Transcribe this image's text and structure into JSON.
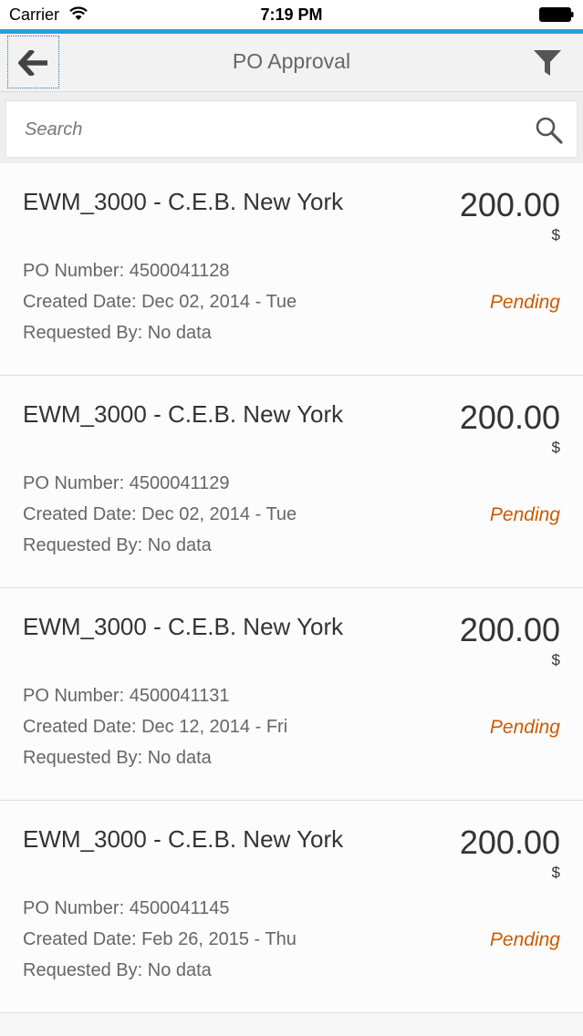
{
  "status_bar": {
    "carrier": "Carrier",
    "time": "7:19 PM"
  },
  "header": {
    "title": "PO Approval",
    "back_icon": "arrow-left-icon",
    "filter_icon": "filter-icon"
  },
  "search": {
    "placeholder": "Search",
    "value": "",
    "icon": "search-icon"
  },
  "colors": {
    "accent": "#2a9fd8",
    "status_pending": "#cc5a00"
  },
  "items": [
    {
      "title": "EWM_3000 - C.E.B. New York",
      "amount": "200.00",
      "currency": "$",
      "po_number": "PO Number: 4500041128",
      "created_date": "Created Date: Dec 02, 2014 - Tue",
      "requested_by": "Requested By: No data",
      "status": "Pending"
    },
    {
      "title": "EWM_3000 - C.E.B. New York",
      "amount": "200.00",
      "currency": "$",
      "po_number": "PO Number: 4500041129",
      "created_date": "Created Date: Dec 02, 2014 - Tue",
      "requested_by": "Requested By: No data",
      "status": "Pending"
    },
    {
      "title": "EWM_3000 - C.E.B. New York",
      "amount": "200.00",
      "currency": "$",
      "po_number": "PO Number: 4500041131",
      "created_date": "Created Date: Dec 12, 2014 - Fri",
      "requested_by": "Requested By: No data",
      "status": "Pending"
    },
    {
      "title": "EWM_3000 - C.E.B. New York",
      "amount": "200.00",
      "currency": "$",
      "po_number": "PO Number: 4500041145",
      "created_date": "Created Date: Feb 26, 2015 - Thu",
      "requested_by": "Requested By: No data",
      "status": "Pending"
    }
  ]
}
